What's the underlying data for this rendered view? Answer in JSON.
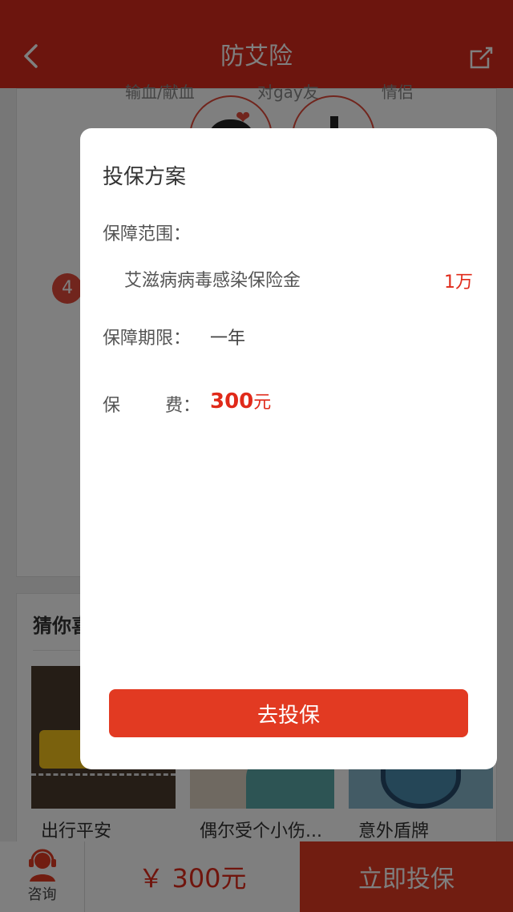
{
  "header": {
    "title": "防艾险",
    "back_icon": "chevron-left-icon",
    "share_icon": "share-icon"
  },
  "background": {
    "risk_labels": [
      "输血/献血",
      "对gay友",
      "情侣"
    ],
    "step_number": "4",
    "guess_title": "猜你喜",
    "products": [
      {
        "name": "出行平安"
      },
      {
        "name": "偶尔受个小伤..."
      },
      {
        "name": "意外盾牌"
      }
    ]
  },
  "bottom_bar": {
    "consult_label": "咨询",
    "price_symbol": "￥",
    "price": "300元",
    "buy_label": "立即投保"
  },
  "modal": {
    "title": "投保方案",
    "coverage_label": "保障范围：",
    "coverage_item": "艾滋病病毒感染保险金",
    "coverage_amount": "1万",
    "period_label": "保障期限：",
    "period_value": "一年",
    "premium_label_1": "保",
    "premium_label_2": "费：",
    "premium_value": "300",
    "premium_unit": "元",
    "button_label": "去投保"
  },
  "colors": {
    "brand_red": "#d82a1c",
    "accent_red": "#e23a22",
    "price_red": "#e02a1a"
  }
}
